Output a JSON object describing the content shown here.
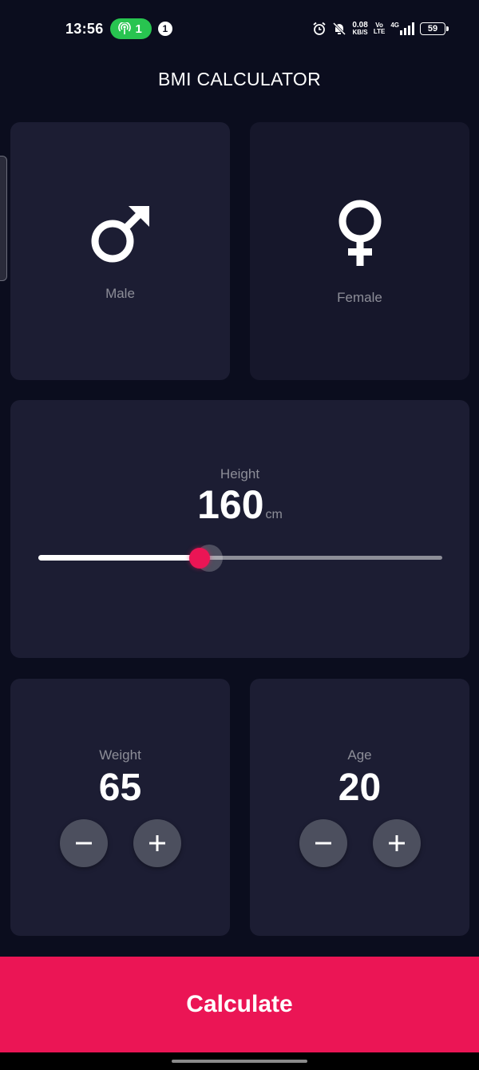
{
  "status_bar": {
    "time": "13:56",
    "hotspot_count": "1",
    "notification_count": "1",
    "speed_value": "0.08",
    "speed_unit": "KB/S",
    "volte_top": "Vo",
    "volte_bottom": "LTE",
    "network": "4G",
    "battery": "59"
  },
  "app_bar": {
    "title": "BMI CALCULATOR"
  },
  "gender": {
    "male_label": "Male",
    "female_label": "Female",
    "selected": "male"
  },
  "height": {
    "label": "Height",
    "value": "160",
    "unit": "cm",
    "min": 120,
    "max": 220,
    "current": 160
  },
  "weight": {
    "label": "Weight",
    "value": "65"
  },
  "age": {
    "label": "Age",
    "value": "20"
  },
  "actions": {
    "calculate_label": "Calculate"
  },
  "colors": {
    "background": "#0b0d1e",
    "card_active": "#1c1d33",
    "card_inactive": "#16172b",
    "accent": "#eb1555",
    "muted_text": "#8d8e98",
    "round_button": "#4c4f5e"
  },
  "icons": {
    "male": "male-symbol-icon",
    "female": "female-symbol-icon",
    "minus": "minus-icon",
    "plus": "plus-icon"
  }
}
